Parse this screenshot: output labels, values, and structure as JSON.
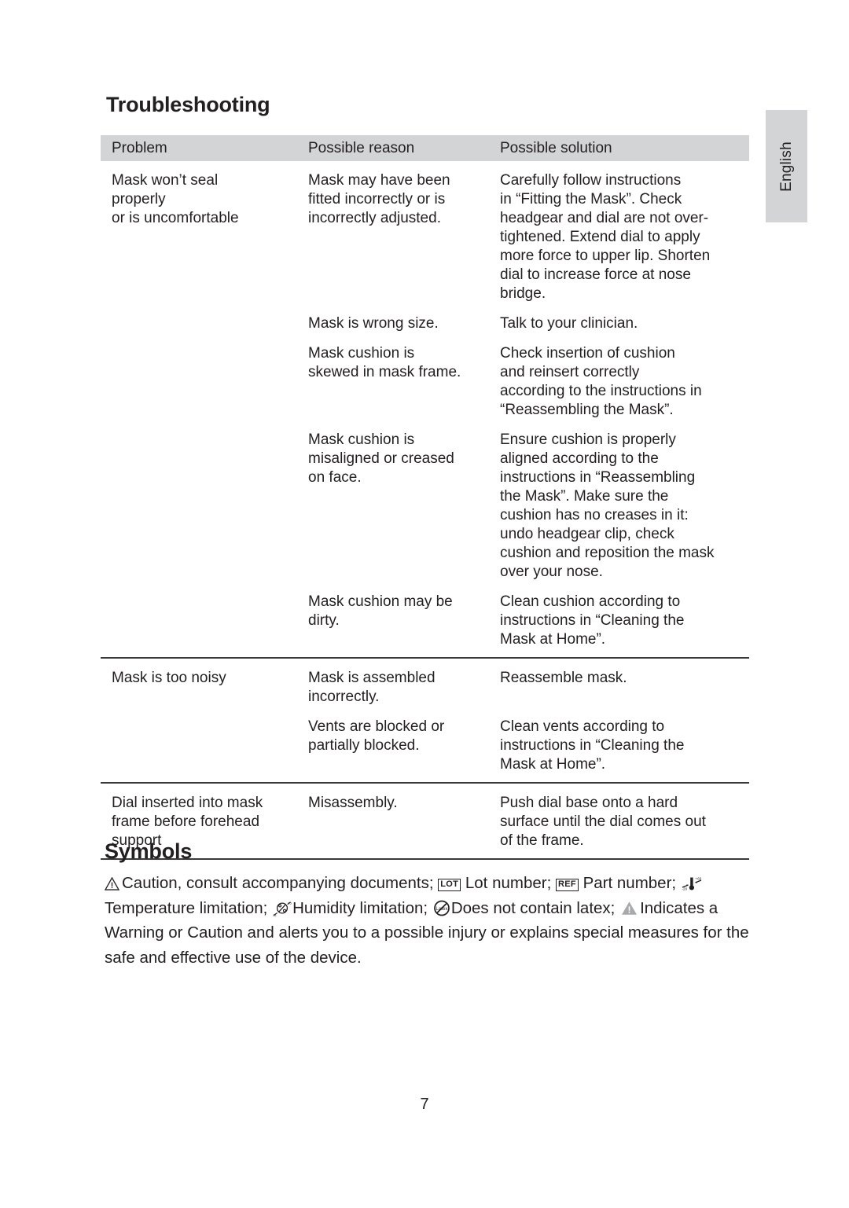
{
  "document": {
    "page_number": "7",
    "language_tab": "English",
    "accent_band_color": "#d3d4d6",
    "rule_color": "#3a3a3a",
    "text_color": "#231f20"
  },
  "troubleshooting": {
    "heading": "Troubleshooting",
    "columns": [
      "Problem",
      "Possible reason",
      "Possible solution"
    ],
    "groups": [
      {
        "problem": "Mask won’t seal\nproperly\nor is uncomfortable",
        "rows": [
          {
            "reason": "Mask may have been\nfitted incorrectly or is\nincorrectly adjusted.",
            "solution": "Carefully follow instructions\nin “Fitting the Mask”. Check\nheadgear and dial are not over-\ntightened. Extend dial to apply\nmore force to upper lip. Shorten\ndial to increase force at nose\nbridge."
          },
          {
            "reason": "Mask is wrong size.",
            "solution": "Talk to your clinician."
          },
          {
            "reason": "Mask cushion is\nskewed in mask frame.",
            "solution": "Check insertion of cushion\nand reinsert correctly\naccording to the instructions in\n“Reassembling the Mask”."
          },
          {
            "reason": "Mask cushion is\nmisaligned or creased\non face.",
            "solution": "Ensure cushion is properly\naligned according to the\ninstructions in “Reassembling\nthe Mask”. Make sure the\ncushion has no creases in it:\nundo headgear clip, check\ncushion and reposition the mask\nover your nose."
          },
          {
            "reason": "Mask cushion may be\ndirty.",
            "solution": "Clean cushion according to\ninstructions in “Cleaning the\nMask at Home”."
          }
        ]
      },
      {
        "problem": "Mask is too noisy",
        "rows": [
          {
            "reason": "Mask is assembled\nincorrectly.",
            "solution": "Reassemble mask."
          },
          {
            "reason": "Vents are blocked or\npartially blocked.",
            "solution": "Clean vents according to\ninstructions in “Cleaning the\nMask at Home”."
          }
        ]
      },
      {
        "problem": "Dial inserted into mask\nframe before forehead\nsupport",
        "rows": [
          {
            "reason": "Misassembly.",
            "solution": "Push dial base onto a hard\nsurface until the dial comes out\nof the frame."
          }
        ]
      }
    ]
  },
  "symbols": {
    "heading": "Symbols",
    "items": [
      {
        "icon": "caution-triangle-icon",
        "text": "Caution, consult accompanying documents;"
      },
      {
        "icon": "lot-number-icon",
        "icon_label": "LOT",
        "text": "Lot number;"
      },
      {
        "icon": "part-number-icon",
        "icon_label": "REF",
        "text": "Part number;"
      },
      {
        "icon": "temperature-limitation-icon",
        "text": "Temperature limitation;"
      },
      {
        "icon": "humidity-limitation-icon",
        "text": "Humidity limitation;"
      },
      {
        "icon": "no-latex-icon",
        "text": "Does not contain latex;"
      },
      {
        "icon": "warning-triangle-icon",
        "text": "Indicates a Warning or Caution and alerts you to a possible injury or explains special measures for the safe and effective use of the device."
      }
    ]
  }
}
